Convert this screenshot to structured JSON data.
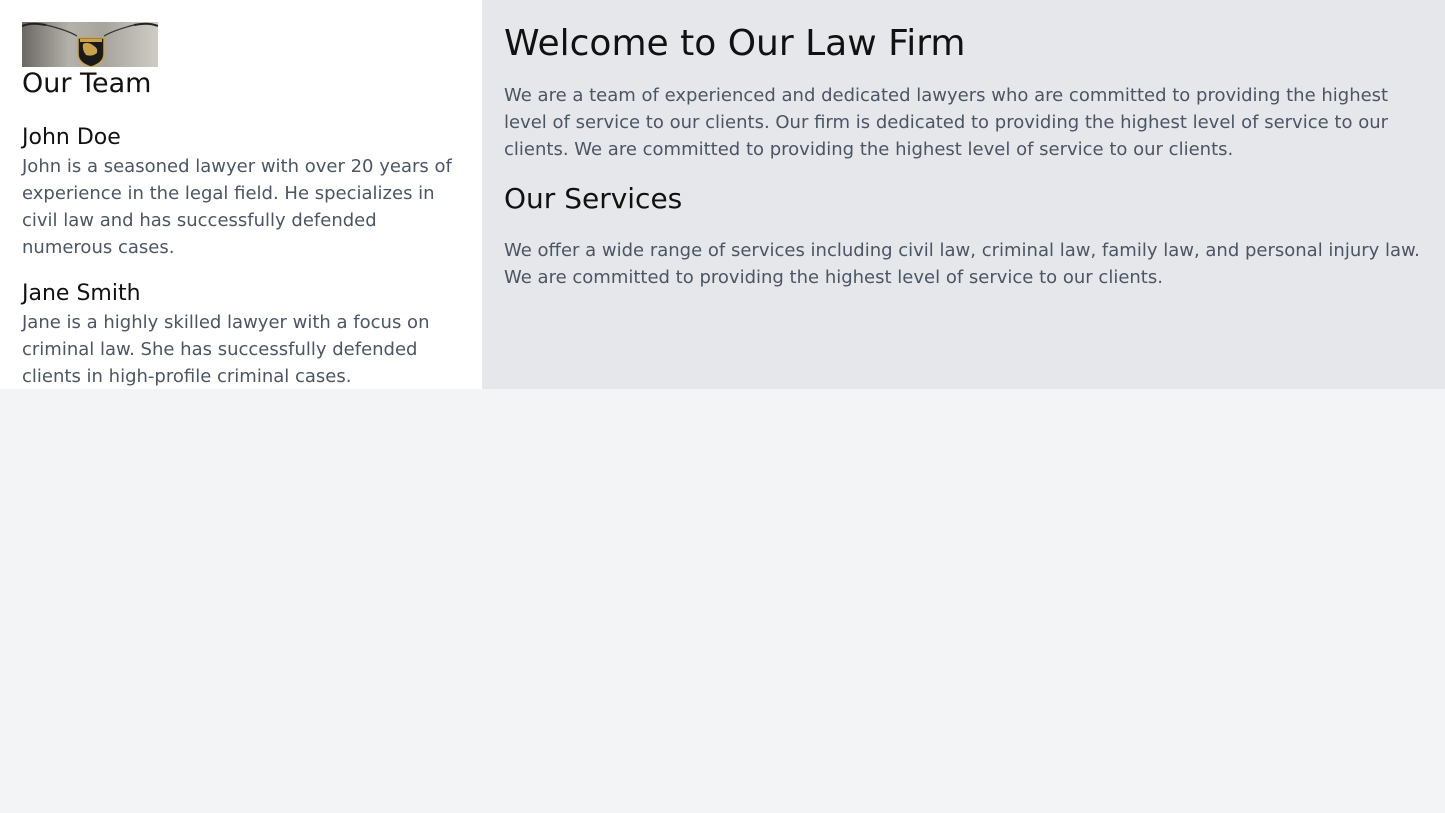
{
  "sidebar": {
    "logo": {
      "icon": "lamborghini-crest-icon"
    },
    "title": "Our Team",
    "members": [
      {
        "name": "John Doe",
        "bio": "John is a seasoned lawyer with over 20 years of experience in the legal field. He specializes in civil law and has successfully defended numerous cases."
      },
      {
        "name": "Jane Smith",
        "bio": "Jane is a highly skilled lawyer with a focus on criminal law. She has successfully defended clients in high-profile criminal cases."
      }
    ]
  },
  "main": {
    "title": "Welcome to Our Law Firm",
    "intro": "We are a team of experienced and dedicated lawyers who are committed to providing the highest level of service to our clients. Our firm is dedicated to providing the highest level of service to our clients. We are committed to providing the highest level of service to our clients.",
    "services_title": "Our Services",
    "services_text": "We offer a wide range of services including civil law, criminal law, family law, and personal injury law. We are committed to providing the highest level of service to our clients."
  },
  "colors": {
    "page_bg": "#f3f4f6",
    "sidebar_bg": "#ffffff",
    "main_bg": "#e5e7eb",
    "heading_text": "#111111",
    "body_text": "#4b5563"
  }
}
